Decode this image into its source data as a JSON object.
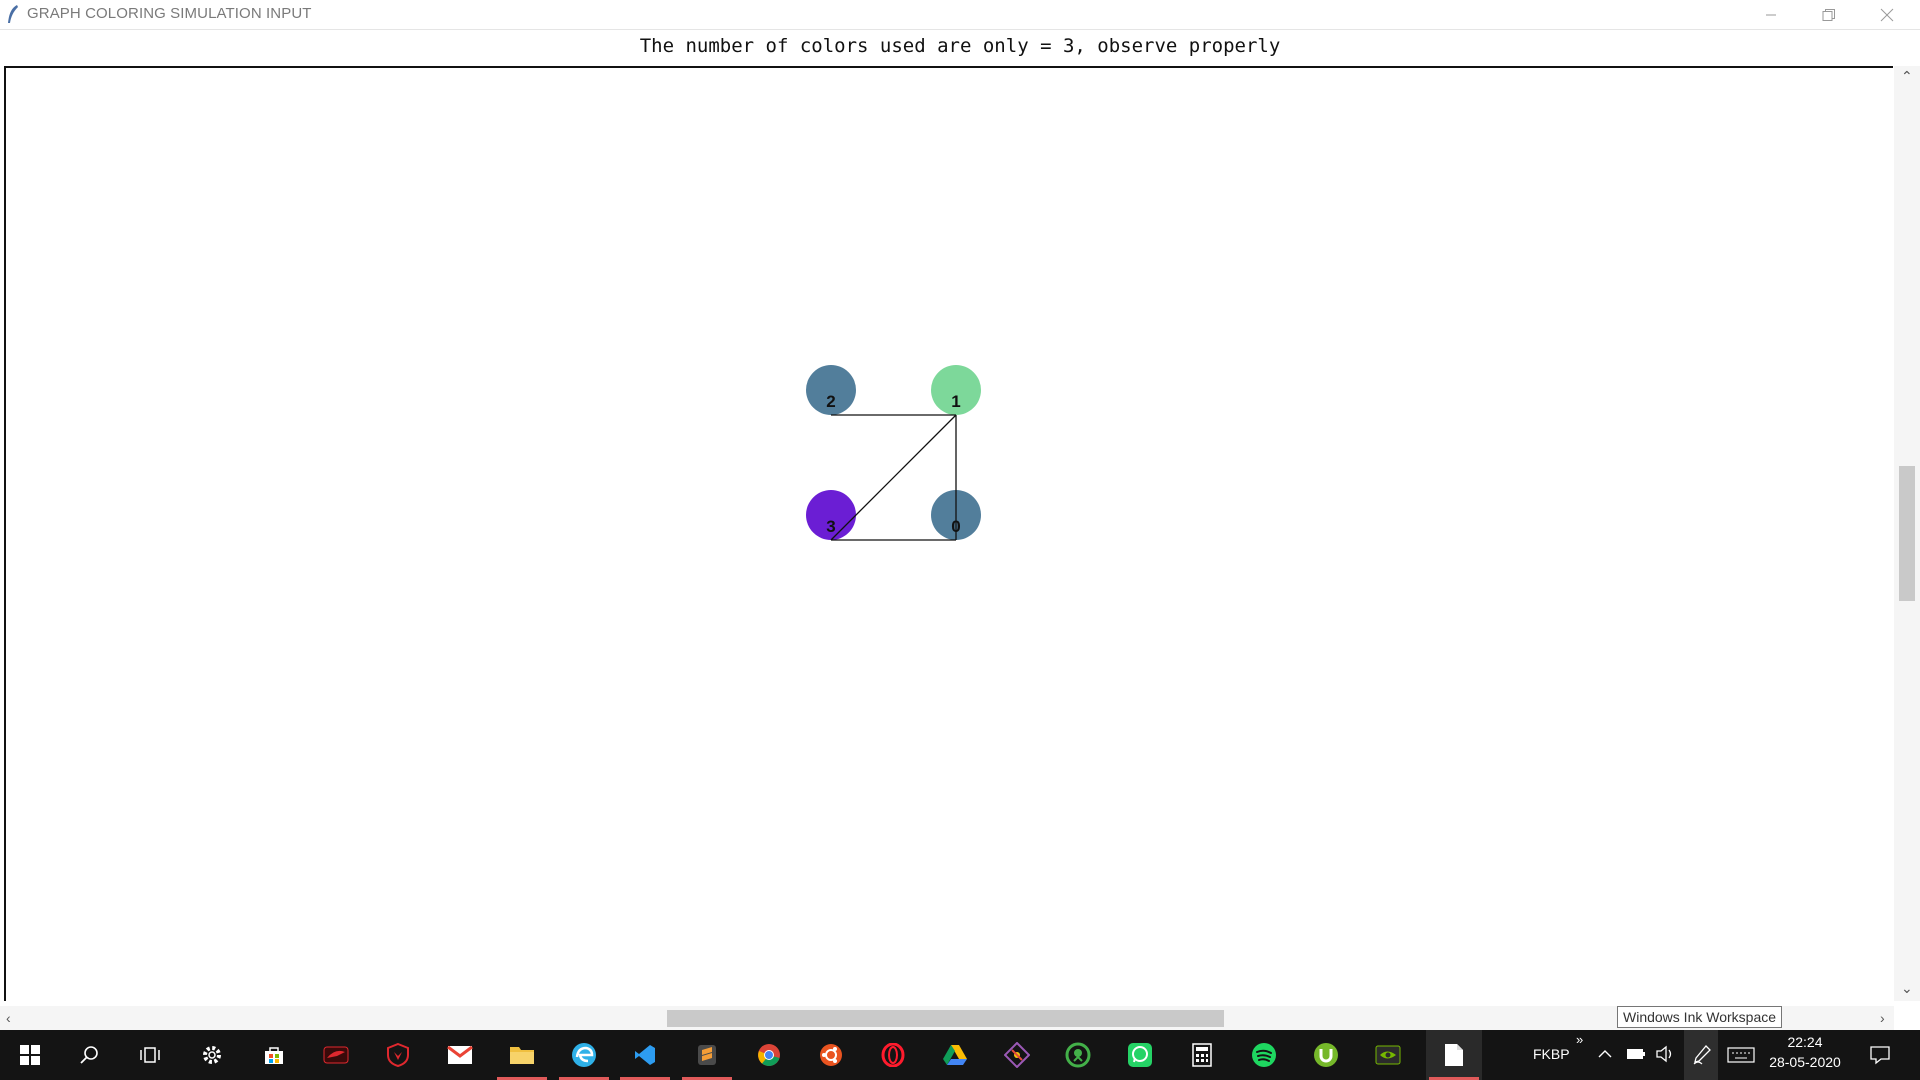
{
  "window": {
    "title": "GRAPH COLORING SIMULATION INPUT"
  },
  "header": {
    "message": "The number of colors used are only = 3, observe properly"
  },
  "graph": {
    "nodes": [
      {
        "label": "2",
        "color": "#527e9b"
      },
      {
        "label": "1",
        "color": "#7dd89a"
      },
      {
        "label": "3",
        "color": "#6b1ed4"
      },
      {
        "label": "0",
        "color": "#527e9b"
      }
    ],
    "edges": [
      [
        "2",
        "1"
      ],
      [
        "1",
        "0"
      ],
      [
        "1",
        "3"
      ],
      [
        "3",
        "0"
      ]
    ]
  },
  "tooltip": {
    "text": "Windows Ink Workspace"
  },
  "taskbar": {
    "icons": [
      {
        "name": "windows-start-icon",
        "color": "#ffffff"
      },
      {
        "name": "search-icon",
        "color": "#ffffff"
      },
      {
        "name": "task-view-icon",
        "color": "#ffffff"
      },
      {
        "name": "settings-gear-icon",
        "color": "#ffffff"
      },
      {
        "name": "microsoft-store-icon",
        "color": "#4cc2ff"
      },
      {
        "name": "msi-dragon-center-icon",
        "color": "#e0282e"
      },
      {
        "name": "msi-shield-icon",
        "color": "#e0282e"
      },
      {
        "name": "gmail-icon",
        "color": "#ea4335"
      },
      {
        "name": "file-explorer-icon",
        "color": "#f0c040"
      },
      {
        "name": "edge-icon",
        "color": "#2fb1e8"
      },
      {
        "name": "vscode-icon",
        "color": "#2d9cf0"
      },
      {
        "name": "sublime-text-icon",
        "color": "#f49d37"
      },
      {
        "name": "chrome-icon",
        "color": "#4caf50"
      },
      {
        "name": "ubuntu-icon",
        "color": "#e95420"
      },
      {
        "name": "opera-icon",
        "color": "#ff1b2d"
      },
      {
        "name": "google-drive-icon",
        "color": "#fbbc04"
      },
      {
        "name": "git-tool-icon",
        "color": "#9b59b6"
      },
      {
        "name": "anaconda-navigator-icon",
        "color": "#43b049"
      },
      {
        "name": "whatsapp-icon",
        "color": "#25d366"
      },
      {
        "name": "calculator-icon",
        "color": "#ffffff"
      },
      {
        "name": "spotify-icon",
        "color": "#1ed760"
      },
      {
        "name": "utorrent-icon",
        "color": "#76b82a"
      },
      {
        "name": "nvidia-icon",
        "color": "#76b900"
      },
      {
        "name": "notepad-icon",
        "color": "#ffffff"
      }
    ],
    "keyboard_layout": "FKBP",
    "time": "22:24",
    "date": "28-05-2020"
  }
}
